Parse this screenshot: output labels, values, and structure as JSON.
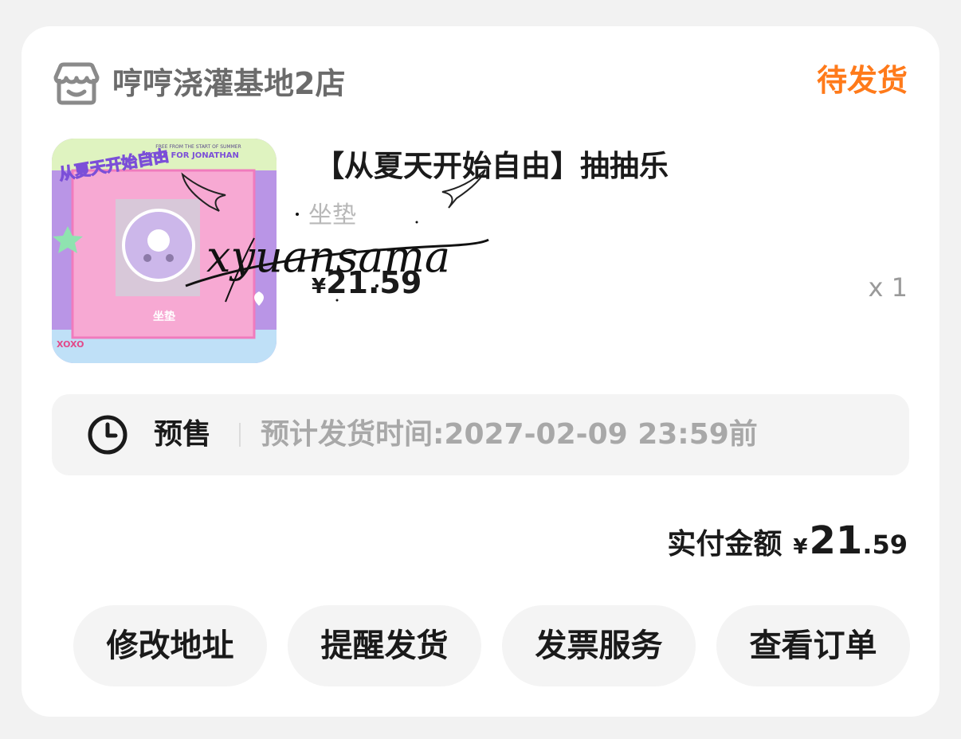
{
  "shop": {
    "icon": "shop-icon",
    "name": "哼哼浇灌基地2店"
  },
  "order": {
    "status": "待发货",
    "status_color": "#ff7a1a"
  },
  "product": {
    "title": "【从夏天开始自由】抽抽乐",
    "subtitle": "坐垫",
    "currency": "¥",
    "price": "21.59",
    "quantity": "x 1",
    "thumbnail": {
      "banner_top": "FREE FROM THE START OF SUMMER",
      "banner_main": "LOVE FOR JONATHAN",
      "badge": "从夏天开始自由",
      "caption": "坐垫",
      "sticker": "XOXO"
    }
  },
  "watermark": {
    "text": "xyuansama"
  },
  "presale": {
    "icon": "clock-icon",
    "label": "预售",
    "eta": "预计发货时间:2027-02-09 23:59前"
  },
  "total": {
    "label": "实付金额",
    "currency": "¥",
    "integer": "21",
    "decimal": ".59"
  },
  "actions": [
    {
      "label": "修改地址"
    },
    {
      "label": "提醒发货"
    },
    {
      "label": "发票服务"
    },
    {
      "label": "查看订单"
    }
  ]
}
